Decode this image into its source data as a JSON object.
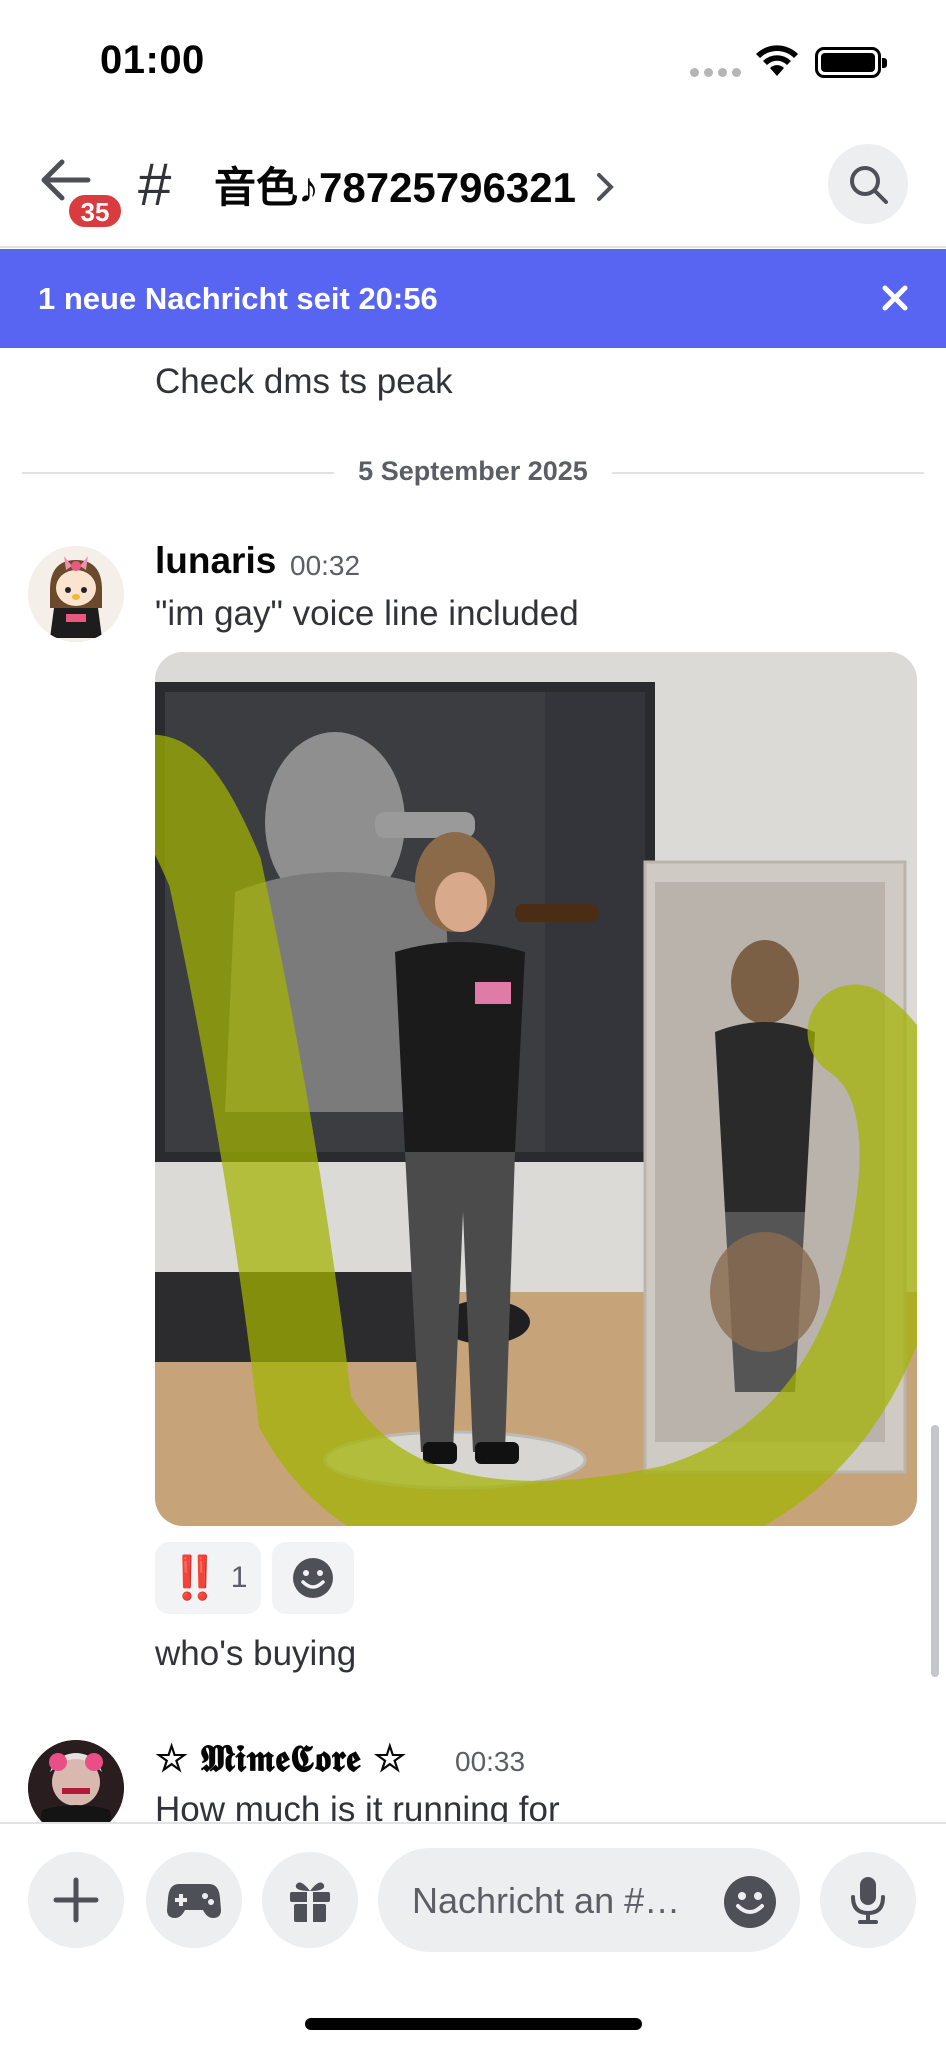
{
  "status_bar": {
    "time": "01:00"
  },
  "header": {
    "unread_badge": "35",
    "hash_symbol": "#",
    "channel_name": "音色♪78725796321"
  },
  "banner": {
    "text": "1 neue Nachricht seit 20:56"
  },
  "messages": {
    "prev_text": "Check dms ts peak",
    "date_divider": "5 September 2025",
    "first": {
      "username": "lunaris",
      "time": "00:32",
      "text": "\"im gay\" voice line included",
      "reactions": [
        {
          "emoji": "‼️",
          "count": "1"
        }
      ],
      "followup": "who's buying"
    },
    "second": {
      "username": "☆ 𝕸𝖎𝖒𝖊𝕮𝖔𝖗𝖊 ☆",
      "time": "00:33",
      "text": "How much is it running for"
    }
  },
  "composer": {
    "placeholder": "Nachricht an #…"
  },
  "colors": {
    "accent": "#5865f2",
    "badge": "#d83c3e",
    "highlight": "#a4b400"
  }
}
